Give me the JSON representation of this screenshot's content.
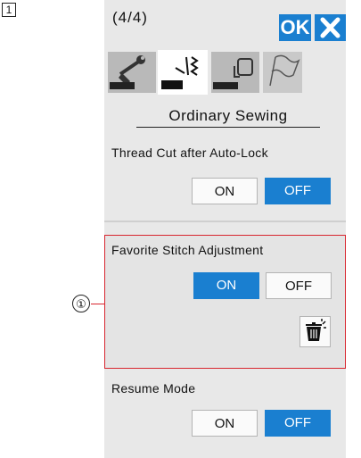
{
  "figure": {
    "step_number": "1",
    "callout": "①"
  },
  "screen": {
    "page_indicator": "(4/4)",
    "ok_label": "OK",
    "close_icon": "close-x-icon",
    "tabs": [
      {
        "icon": "wrench-machine-icon",
        "active": false
      },
      {
        "icon": "sewing-stitch-machine-icon",
        "active": true
      },
      {
        "icon": "embroidery-hoop-machine-icon",
        "active": false
      },
      {
        "icon": "flag-icon",
        "active": false
      }
    ],
    "section_title": "Ordinary Sewing",
    "settings": {
      "thread_cut": {
        "label": "Thread Cut after Auto-Lock",
        "on_label": "ON",
        "off_label": "OFF",
        "selected": "OFF"
      },
      "favorite_stitch": {
        "label": "Favorite Stitch Adjustment",
        "on_label": "ON",
        "off_label": "OFF",
        "selected": "ON",
        "delete_icon": "trash-delete-icon"
      },
      "resume_mode": {
        "label": "Resume Mode",
        "on_label": "ON",
        "off_label": "OFF",
        "selected": "OFF"
      }
    },
    "colors": {
      "accent_blue": "#1a7fd0",
      "highlight_red": "#d8262f",
      "panel_gray": "#e8e8e8"
    }
  }
}
